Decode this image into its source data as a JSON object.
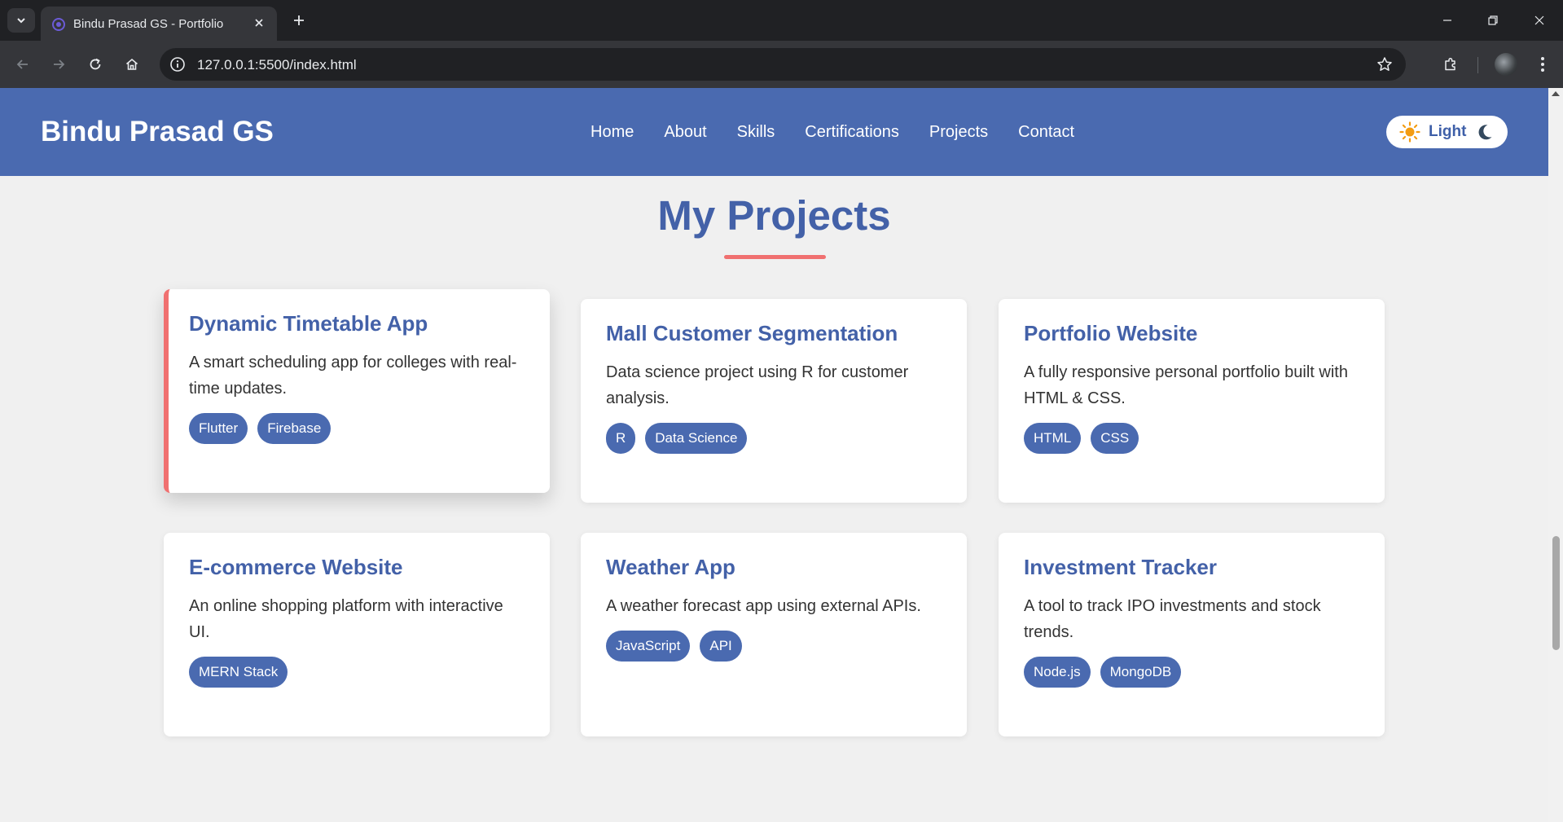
{
  "browser": {
    "tab_title": "Bindu Prasad GS - Portfolio",
    "url": "127.0.0.1:5500/index.html"
  },
  "site": {
    "brand": "Bindu Prasad GS",
    "nav": [
      "Home",
      "About",
      "Skills",
      "Certifications",
      "Projects",
      "Contact"
    ],
    "theme_toggle_label": "Light"
  },
  "projects_section": {
    "title": "My Projects",
    "projects": [
      {
        "title": "Dynamic Timetable App",
        "description": "A smart scheduling app for colleges with real-time updates.",
        "tags": [
          "Flutter",
          "Firebase"
        ]
      },
      {
        "title": "Mall Customer Segmentation",
        "description": "Data science project using R for customer analysis.",
        "tags": [
          "R",
          "Data Science"
        ]
      },
      {
        "title": "Portfolio Website",
        "description": "A fully responsive personal portfolio built with HTML & CSS.",
        "tags": [
          "HTML",
          "CSS"
        ]
      },
      {
        "title": "E-commerce Website",
        "description": "An online shopping platform with interactive UI.",
        "tags": [
          "MERN Stack"
        ]
      },
      {
        "title": "Weather App",
        "description": "A weather forecast app using external APIs.",
        "tags": [
          "JavaScript",
          "API"
        ]
      },
      {
        "title": "Investment Tracker",
        "description": "A tool to track IPO investments and stock trends.",
        "tags": [
          "Node.js",
          "MongoDB"
        ]
      }
    ]
  },
  "colors": {
    "header_bg": "#4a6ab0",
    "accent_title": "#4361a8",
    "underline_accent": "#f07070",
    "page_bg": "#f0f0f0"
  }
}
